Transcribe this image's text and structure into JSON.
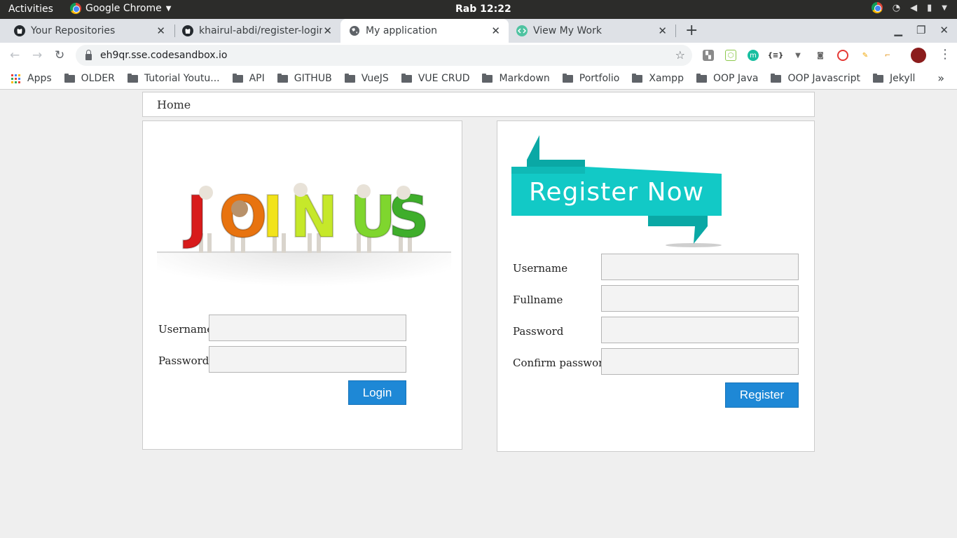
{
  "desktop": {
    "activities": "Activities",
    "app_name": "Google Chrome",
    "clock": "Rab 12:22"
  },
  "tabs": [
    {
      "label": "Your Repositories",
      "icon": "github-icon"
    },
    {
      "label": "khairul-abdi/register-login",
      "icon": "github-icon"
    },
    {
      "label": "My application",
      "icon": "globe-icon",
      "active": true
    },
    {
      "label": "View My Work",
      "icon": "codesandbox-icon"
    }
  ],
  "address_bar": {
    "url": "eh9qr.sse.codesandbox.io"
  },
  "bookmarks": [
    {
      "label": "Apps",
      "type": "apps"
    },
    {
      "label": "OLDER"
    },
    {
      "label": "Tutorial Youtu..."
    },
    {
      "label": "API"
    },
    {
      "label": "GITHUB"
    },
    {
      "label": "VueJS"
    },
    {
      "label": "VUE CRUD"
    },
    {
      "label": "Markdown"
    },
    {
      "label": "Portfolio"
    },
    {
      "label": "Xampp"
    },
    {
      "label": "OOP Java"
    },
    {
      "label": "OOP Javascript"
    },
    {
      "label": "Jekyll"
    }
  ],
  "navbar": {
    "home": "Home"
  },
  "login": {
    "image_text": "JOIN US",
    "username_label": "Username",
    "username_value": "",
    "password_label": "Password",
    "password_value": "",
    "submit_label": "Login"
  },
  "register": {
    "banner_text": "Register Now",
    "username_label": "Username",
    "fullname_label": "Fullname",
    "password_label": "Password",
    "confirm_label": "Confirm password",
    "submit_label": "Register"
  },
  "colors": {
    "button_blue": "#1e88d6",
    "banner_teal": "#12c9c6",
    "join_letters": [
      "#d81b1b",
      "#e8730f",
      "#f2e31a",
      "#c6e82a",
      "#7fd62e",
      "#3fae2b"
    ]
  }
}
